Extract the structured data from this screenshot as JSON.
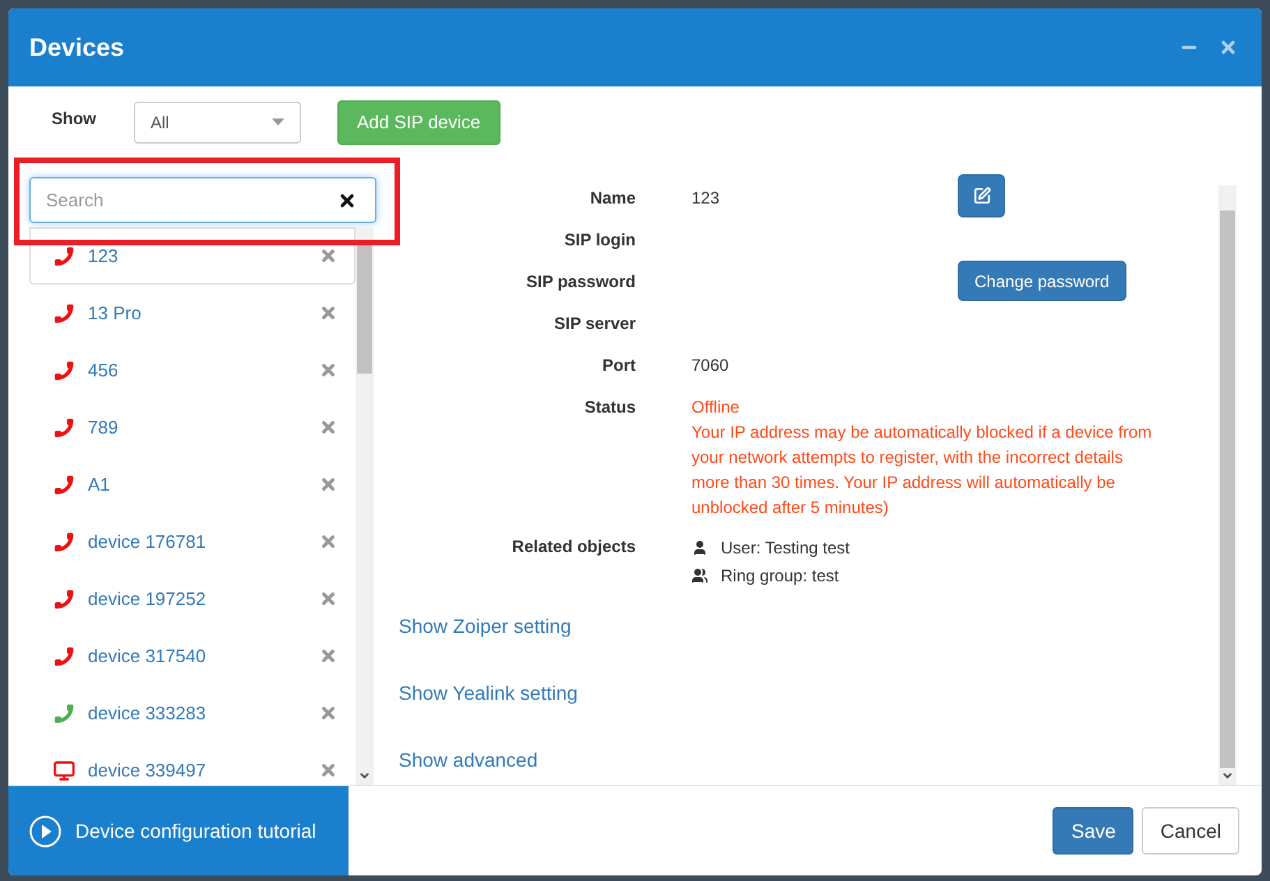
{
  "window": {
    "title": "Devices"
  },
  "filter": {
    "label": "Show",
    "value": "All"
  },
  "add_button": "Add SIP device",
  "search": {
    "placeholder": "Search"
  },
  "devices": [
    {
      "name": "123",
      "kind": "phone",
      "color": "#ee1111",
      "selected": true
    },
    {
      "name": "13 Pro",
      "kind": "phone",
      "color": "#ee1111",
      "selected": false
    },
    {
      "name": "456",
      "kind": "phone",
      "color": "#ee1111",
      "selected": false
    },
    {
      "name": "789",
      "kind": "phone",
      "color": "#ee1111",
      "selected": false
    },
    {
      "name": "A1",
      "kind": "phone",
      "color": "#ee1111",
      "selected": false
    },
    {
      "name": "device 176781",
      "kind": "phone",
      "color": "#ee1111",
      "selected": false
    },
    {
      "name": "device 197252",
      "kind": "phone",
      "color": "#ee1111",
      "selected": false
    },
    {
      "name": "device 317540",
      "kind": "phone",
      "color": "#ee1111",
      "selected": false
    },
    {
      "name": "device 333283",
      "kind": "phone",
      "color": "#4caf50",
      "selected": false
    },
    {
      "name": "device 339497",
      "kind": "monitor",
      "color": "#ee1111",
      "selected": false
    }
  ],
  "details": {
    "fields": [
      {
        "label": "Name",
        "value": "123",
        "kind": "edit"
      },
      {
        "label": "SIP login",
        "kind": "plain"
      },
      {
        "label": "SIP password",
        "kind": "button",
        "button": "Change password"
      },
      {
        "label": "SIP server",
        "kind": "plain"
      },
      {
        "label": "Port",
        "value": "7060",
        "kind": "plain"
      },
      {
        "label": "Status",
        "kind": "status",
        "value": "Offline",
        "note": "Your IP address may be automatically blocked if a device from your network attempts to register, with the incorrect details more than 30 times. Your IP address will automatically be unblocked after 5 minutes)"
      }
    ],
    "related": {
      "label": "Related objects",
      "items": [
        {
          "kind": "user",
          "text": "User: Testing test"
        },
        {
          "kind": "group",
          "text": "Ring group: test"
        }
      ]
    },
    "links": [
      "Show Zoiper setting",
      "Show Yealink setting",
      "Show advanced"
    ]
  },
  "footer": {
    "tutorial": "Device configuration tutorial",
    "buttons": [
      {
        "label": "Save",
        "kind": "primary"
      },
      {
        "label": "Cancel",
        "kind": "default"
      }
    ]
  }
}
